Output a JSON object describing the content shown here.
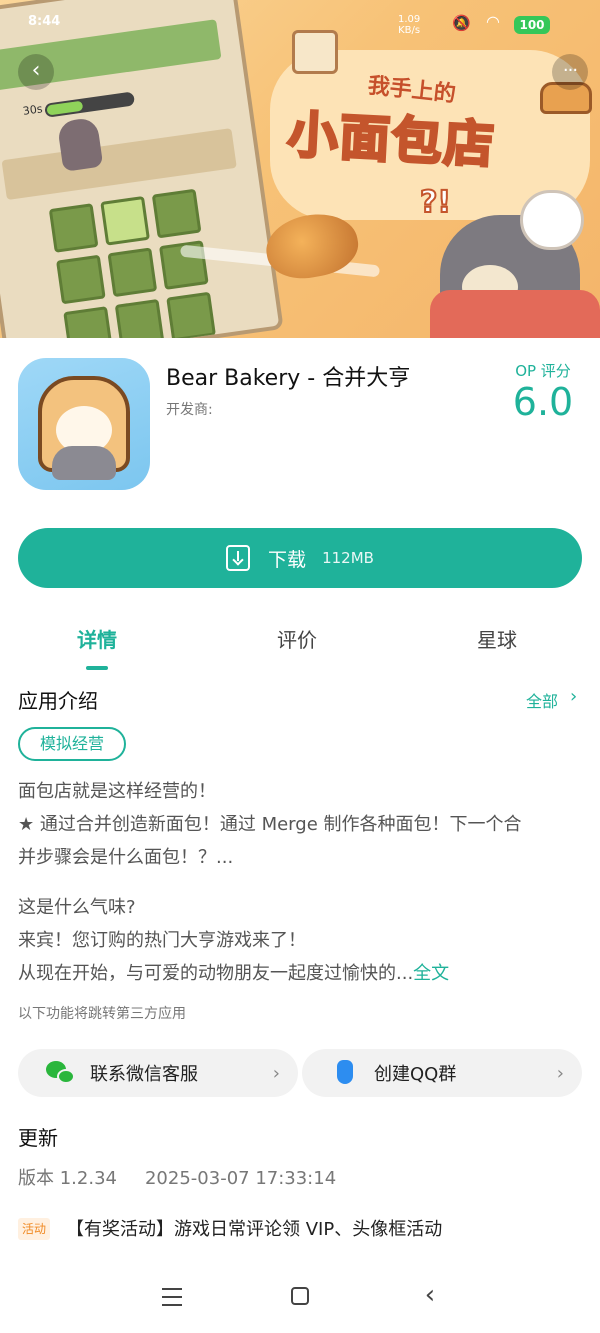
{
  "status_bar": {
    "time": "8:44",
    "net_speed": "1.09",
    "net_unit": "KB/s",
    "battery": "100"
  },
  "banner": {
    "title_small": "我手上的",
    "title_big": "小面包店",
    "exclaim": "?!",
    "board_timer": "30s"
  },
  "app": {
    "name": "Bear Bakery - 合并大亨",
    "developer_label": "开发商:",
    "rating_label": "OP 评分",
    "rating_value": "6.0"
  },
  "download": {
    "label": "下载",
    "size": "112MB"
  },
  "tabs": [
    {
      "label": "详情",
      "active": true
    },
    {
      "label": "评价",
      "active": false
    },
    {
      "label": "星球",
      "active": false
    }
  ],
  "intro": {
    "title": "应用介绍",
    "see_all": "全部",
    "tag": "模拟经营",
    "desc_line1": "面包店就是这样经营的！",
    "desc_line2": "★ 通过合并创造新面包！通过 Merge 制作各种面包！下一个合",
    "desc_line3": "并步骤会是什么面包！？...",
    "desc_line4": "这是什么气味?",
    "desc_line5": "来宾！您订购的热门大亨游戏来了！",
    "desc_line6": "从现在开始，与可爱的动物朋友一起度过愉快的...",
    "full_text": "全文",
    "third_party_note": "以下功能将跳转第三方应用"
  },
  "services": {
    "wechat_label": "联系微信客服",
    "qq_label": "创建QQ群"
  },
  "update": {
    "title": "更新",
    "version": "版本 1.2.34",
    "date": "2025-03-07 17:33:14",
    "event_badge": "活动",
    "event_text": "【有奖活动】游戏日常评论领 VIP、头像框活动"
  },
  "icons": {
    "back": "chevron-left-icon",
    "more": "more-dots-icon",
    "download": "download-icon",
    "wechat": "wechat-icon",
    "qq": "qq-icon"
  },
  "colors": {
    "accent": "#1fb29a",
    "event": "#f08a24"
  }
}
